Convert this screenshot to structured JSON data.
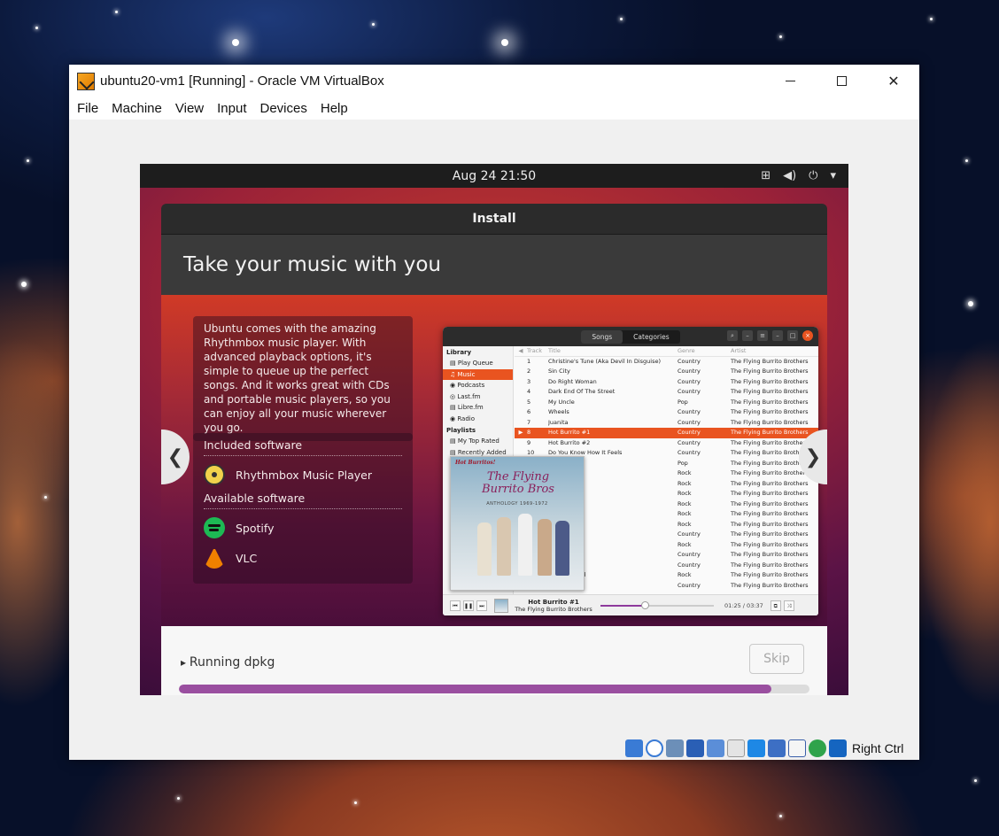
{
  "window": {
    "title": "ubuntu20-vm1 [Running] - Oracle VM VirtualBox",
    "menu": [
      "File",
      "Machine",
      "View",
      "Input",
      "Devices",
      "Help"
    ],
    "minimize_icon": "minimize-icon",
    "maximize_icon": "maximize-icon",
    "close_icon": "close-icon"
  },
  "guest_topbar": {
    "datetime": "Aug 24  21:50",
    "tray_icons": [
      "network-icon",
      "volume-icon",
      "power-icon",
      "caret-down-icon"
    ]
  },
  "installer": {
    "header": "Install",
    "slide_title": "Take your music with you",
    "description": "Ubuntu comes with the amazing Rhythmbox music player. With advanced playback options, it's simple to queue up the perfect songs. And it works great with CDs and portable music players, so you can enjoy all your music wherever you go.",
    "included_heading": "Included software",
    "included": [
      {
        "name": "Rhythmbox Music Player",
        "icon": "rhythmbox-icon"
      }
    ],
    "available_heading": "Available software",
    "available": [
      {
        "name": "Spotify",
        "icon": "spotify-icon"
      },
      {
        "name": "VLC",
        "icon": "vlc-icon"
      }
    ],
    "prev_glyph": "❮",
    "next_glyph": "❯",
    "status": "Running dpkg",
    "skip_label": "Skip",
    "progress_fraction": 0.94
  },
  "rhythmbox": {
    "tabs": [
      "Songs",
      "Categories"
    ],
    "sidebar": {
      "library_heading": "Library",
      "library": [
        "Play Queue",
        "Music",
        "Podcasts",
        "Last.fm",
        "Libre.fm",
        "Radio"
      ],
      "selected": 1,
      "playlists_heading": "Playlists",
      "playlists": [
        "My Top Rated",
        "Recently Added"
      ]
    },
    "columns": [
      "Track",
      "Title",
      "Genre",
      "Artist"
    ],
    "rows": [
      {
        "track": "1",
        "title": "Christine's Tune (Aka Devil In Disguise)",
        "genre": "Country",
        "artist": "The Flying Burrito Brothers"
      },
      {
        "track": "2",
        "title": "Sin City",
        "genre": "Country",
        "artist": "The Flying Burrito Brothers"
      },
      {
        "track": "3",
        "title": "Do Right Woman",
        "genre": "Country",
        "artist": "The Flying Burrito Brothers"
      },
      {
        "track": "4",
        "title": "Dark End Of The Street",
        "genre": "Country",
        "artist": "The Flying Burrito Brothers"
      },
      {
        "track": "5",
        "title": "My Uncle",
        "genre": "Pop",
        "artist": "The Flying Burrito Brothers"
      },
      {
        "track": "6",
        "title": "Wheels",
        "genre": "Country",
        "artist": "The Flying Burrito Brothers"
      },
      {
        "track": "7",
        "title": "Juanita",
        "genre": "Country",
        "artist": "The Flying Burrito Brothers"
      },
      {
        "track": "8",
        "title": "Hot Burrito #1",
        "genre": "Country",
        "artist": "The Flying Burrito Brothers",
        "playing": true
      },
      {
        "track": "9",
        "title": "Hot Burrito #2",
        "genre": "Country",
        "artist": "The Flying Burrito Brothers"
      },
      {
        "track": "10",
        "title": "Do You Know How It Feels",
        "genre": "Country",
        "artist": "The Flying Burrito Brothers"
      },
      {
        "track": "",
        "title": "",
        "genre": "Pop",
        "artist": "The Flying Burrito Brothers"
      },
      {
        "track": "",
        "title": "",
        "genre": "Rock",
        "artist": "The Flying Burrito Brothers"
      },
      {
        "track": "",
        "title": "",
        "genre": "Rock",
        "artist": "The Flying Burrito Brothers"
      },
      {
        "track": "",
        "title": "e",
        "genre": "Rock",
        "artist": "The Flying Burrito Brothers"
      },
      {
        "track": "",
        "title": "n Queen",
        "genre": "Rock",
        "artist": "The Flying Burrito Brothers"
      },
      {
        "track": "",
        "title": "n Go",
        "genre": "Rock",
        "artist": "The Flying Burrito Brothers"
      },
      {
        "track": "",
        "title": "Fog",
        "genre": "Rock",
        "artist": "The Flying Burrito Brothers"
      },
      {
        "track": "",
        "title": "ng",
        "genre": "Country",
        "artist": "The Flying Burrito Brothers"
      },
      {
        "track": "",
        "title": "",
        "genre": "Rock",
        "artist": "The Flying Burrito Brothers"
      },
      {
        "track": "",
        "title": "",
        "genre": "Country",
        "artist": "The Flying Burrito Brothers"
      },
      {
        "track": "",
        "title": "Singer",
        "genre": "Country",
        "artist": "The Flying Burrito Brothers"
      },
      {
        "track": "",
        "title": "r Churchyard",
        "genre": "Rock",
        "artist": "The Flying Burrito Brothers"
      },
      {
        "track": "",
        "title": "",
        "genre": "Country",
        "artist": "The Flying Burrito Brothers"
      }
    ],
    "album_art": {
      "top": "Hot Burritos!",
      "band": "The Flying Burrito Bros",
      "sub": "ANTHOLOGY 1969-1972"
    },
    "now_playing": {
      "title": "Hot Burrito #1",
      "artist": "The Flying Burrito Brothers"
    },
    "time": "01:25 / 03:37",
    "position_fraction": 0.39
  },
  "statusbar": {
    "icons": [
      "hard-disk-icon",
      "optical-disk-icon",
      "audio-icon",
      "network-icon",
      "usb-icon",
      "shared-folder-icon",
      "display-icon",
      "video-capture-icon",
      "recording-icon",
      "cpu-icon",
      "mouse-integration-icon",
      "keyboard-capture-icon"
    ],
    "host_key": "Right Ctrl"
  }
}
